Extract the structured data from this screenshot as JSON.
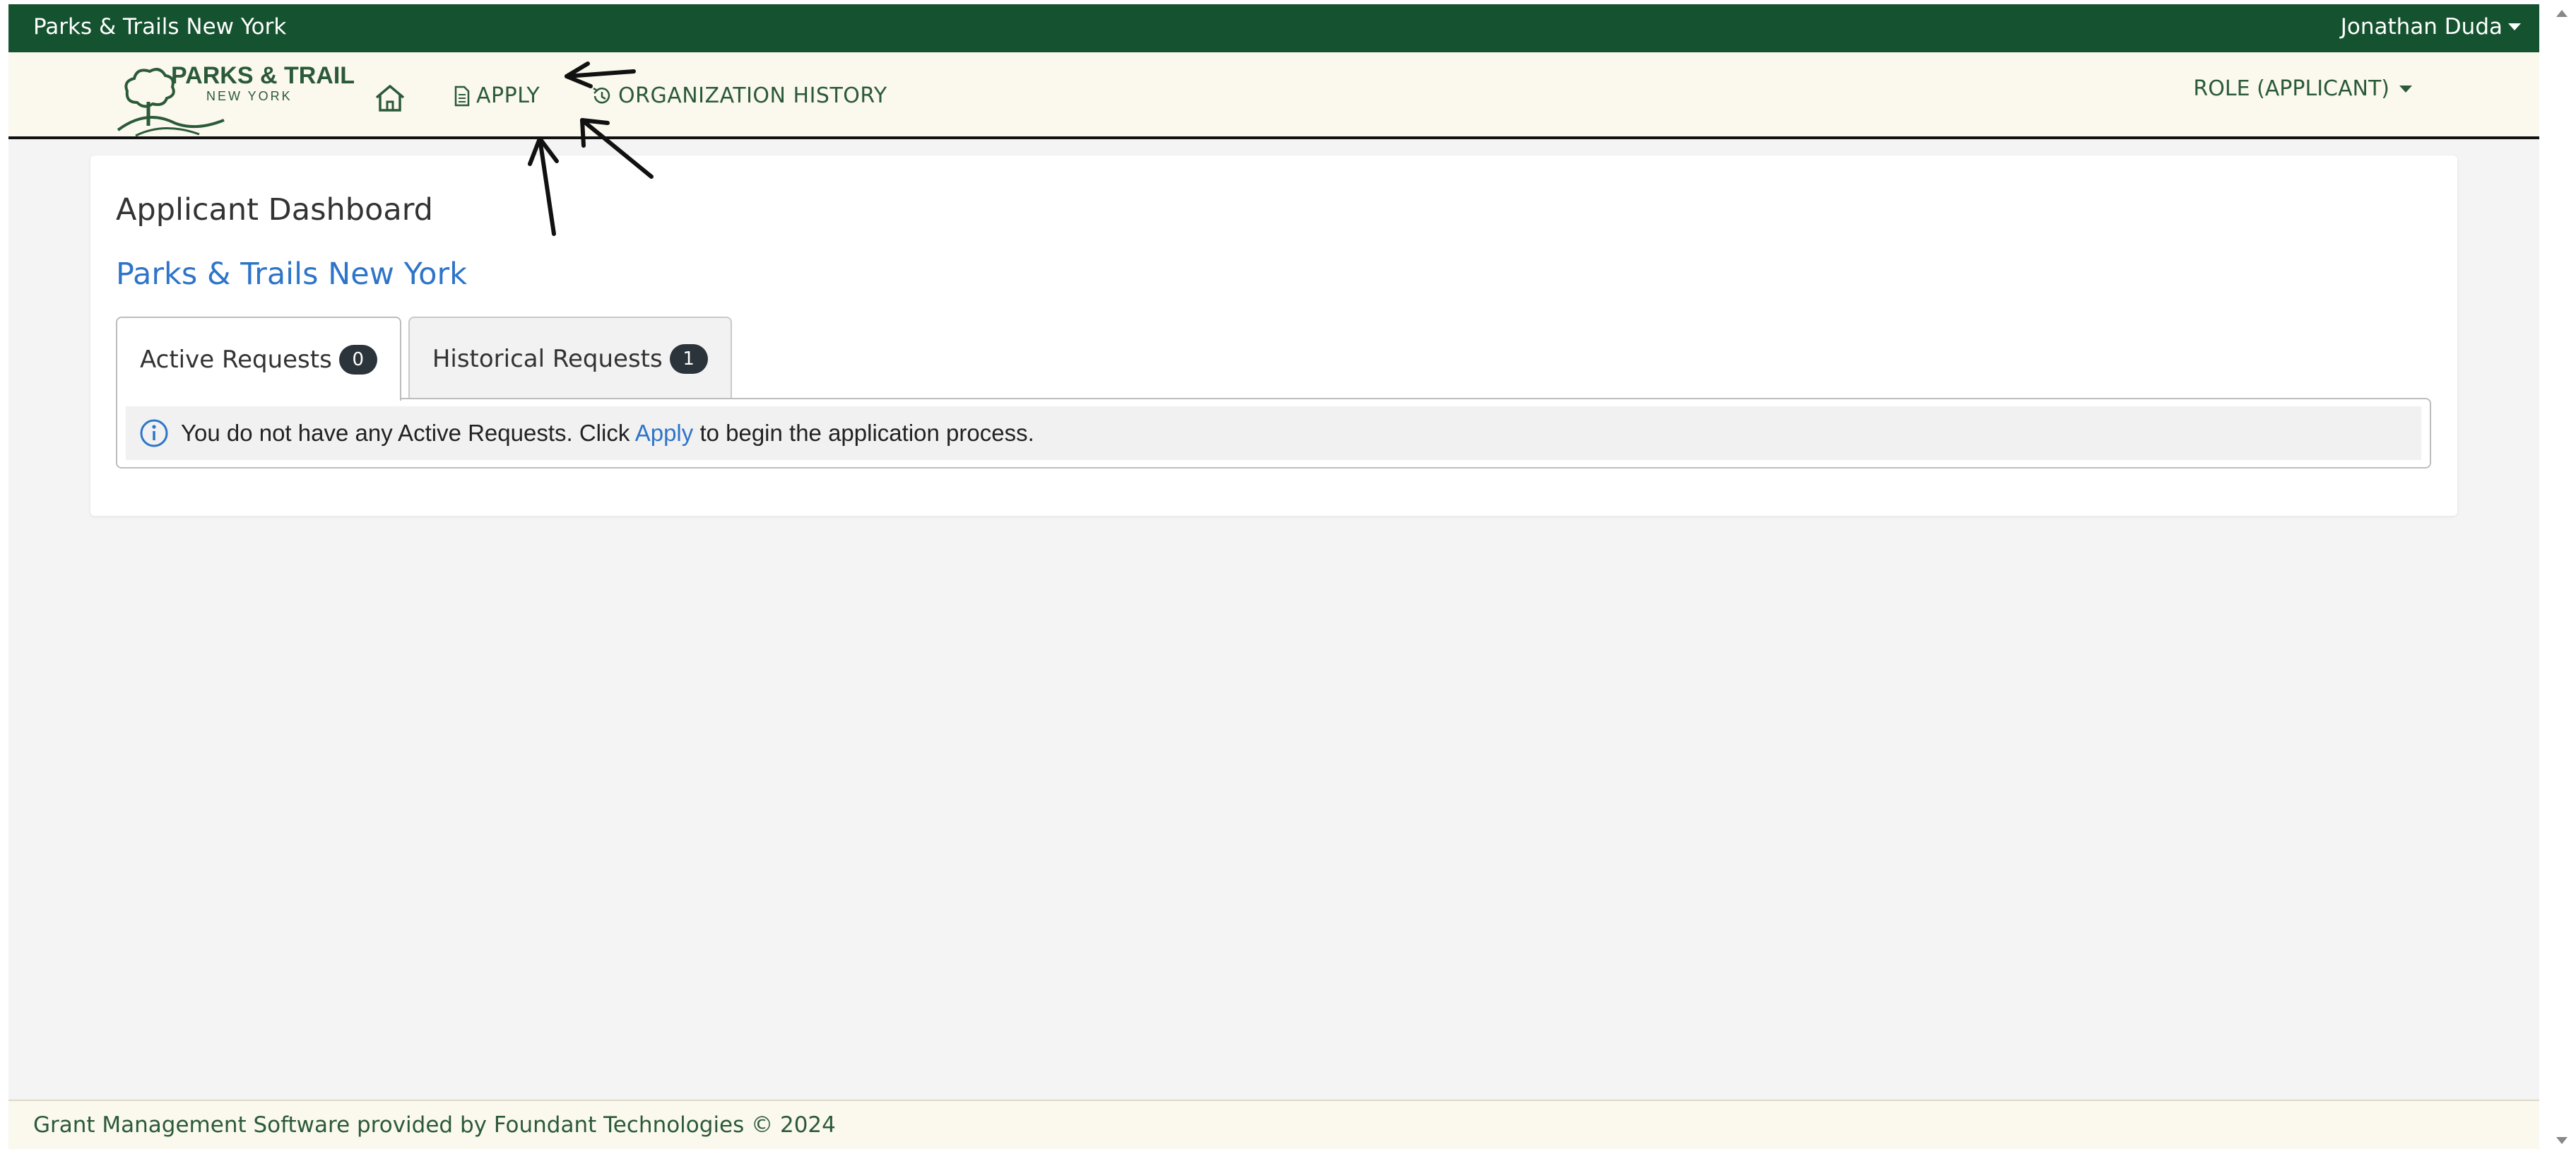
{
  "topbar": {
    "org_name": "Parks & Trails New York",
    "user_name": "Jonathan Duda"
  },
  "navbar": {
    "logo_icon": "parks-trails-logo",
    "logo_line1": "PARKS & TRAILS",
    "logo_line2": "NEW YORK",
    "home_icon": "home-icon",
    "apply_icon": "document-icon",
    "apply_label": "APPLY",
    "history_icon": "history-icon",
    "history_label": "ORGANIZATION HISTORY",
    "role_label": "ROLE (APPLICANT)"
  },
  "main": {
    "title": "Applicant Dashboard",
    "org_link": "Parks & Trails New York",
    "tabs": [
      {
        "label": "Active Requests",
        "count": "0"
      },
      {
        "label": "Historical Requests",
        "count": "1"
      }
    ],
    "alert": {
      "icon": "info-icon",
      "text_before": "You do not have any Active Requests. Click",
      "link_text": "Apply",
      "text_after": "to begin the application process."
    }
  },
  "footer": {
    "text": "Grant Management Software provided by Foundant Technologies © 2024"
  },
  "colors": {
    "topbar_bg": "#155230",
    "navbar_bg": "#fbf8ee",
    "link_blue": "#2e74c9",
    "nav_green": "#2b5a38"
  }
}
